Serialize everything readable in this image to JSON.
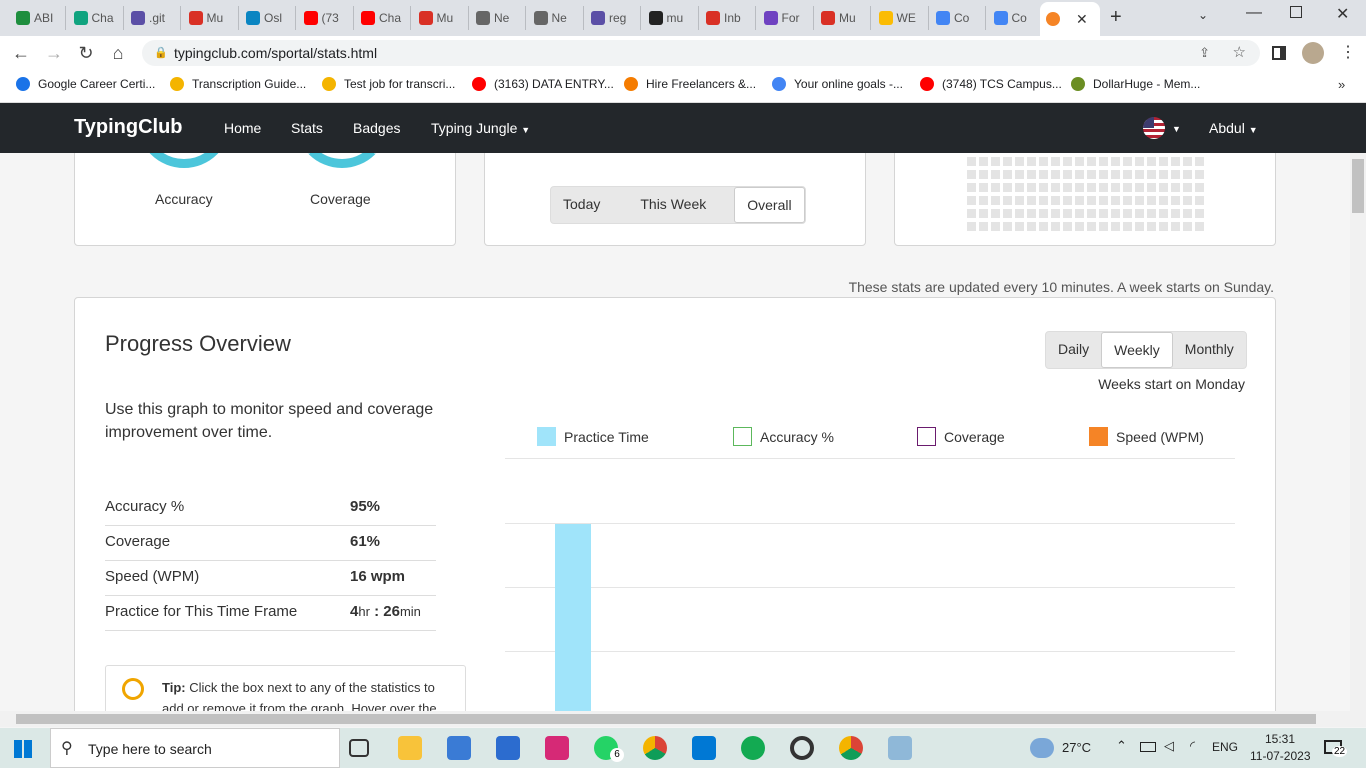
{
  "tabs": [
    {
      "label": "ABI",
      "color": "#1e8e3e",
      "icon": "sheets-icon"
    },
    {
      "label": "Cha",
      "color": "#10a37f",
      "icon": "chatgpt-icon"
    },
    {
      "label": ".git",
      "color": "#5b4fa6",
      "icon": "github-icon"
    },
    {
      "label": "Mu",
      "color": "#d93025",
      "icon": "gmail-icon"
    },
    {
      "label": "Osl",
      "color": "#0a85c2",
      "icon": "app-icon"
    },
    {
      "label": "(73",
      "color": "#ff0000",
      "icon": "youtube-icon"
    },
    {
      "label": "Cha",
      "color": "#ff0000",
      "icon": "youtube-icon"
    },
    {
      "label": "Mu",
      "color": "#d93025",
      "icon": "gmail-icon"
    },
    {
      "label": "Ne",
      "color": "#666",
      "icon": "globe-icon"
    },
    {
      "label": "Ne",
      "color": "#666",
      "icon": "globe-icon"
    },
    {
      "label": "reg",
      "color": "#5b4fa6",
      "icon": "github-icon"
    },
    {
      "label": "mu",
      "color": "#222",
      "icon": "github-icon"
    },
    {
      "label": "Inb",
      "color": "#d93025",
      "icon": "gmail-icon"
    },
    {
      "label": "For",
      "color": "#6f42c1",
      "icon": "bootstrap-icon"
    },
    {
      "label": "Mu",
      "color": "#d93025",
      "icon": "gmail-icon"
    },
    {
      "label": "WE",
      "color": "#fbbc04",
      "icon": "drive-icon"
    },
    {
      "label": "Co",
      "color": "#4285f4",
      "icon": "docs-icon"
    },
    {
      "label": "Co",
      "color": "#4285f4",
      "icon": "docs-icon"
    }
  ],
  "url": "typingclub.com/sportal/stats.html",
  "bookmarks": [
    {
      "label": "Google Career Certi...",
      "color": "#1a73e8"
    },
    {
      "label": "Transcription Guide...",
      "color": "#f4b400"
    },
    {
      "label": "Test job for transcri...",
      "color": "#f4b400"
    },
    {
      "label": "(3163) DATA ENTRY...",
      "color": "#ff0000"
    },
    {
      "label": "Hire Freelancers &...",
      "color": "#f57c00"
    },
    {
      "label": "Your online goals -...",
      "color": "#4285f4"
    },
    {
      "label": "(3748) TCS Campus...",
      "color": "#ff0000"
    },
    {
      "label": "DollarHuge - Mem...",
      "color": "#6b8e23"
    }
  ],
  "site": {
    "brand": "TypingClub",
    "nav": [
      "Home",
      "Stats",
      "Badges",
      "Typing Jungle"
    ],
    "user": "Abdul"
  },
  "top": {
    "accuracy_label": "Accuracy",
    "coverage_label": "Coverage",
    "periods": [
      "Today",
      "This Week",
      "Overall"
    ],
    "selected": "Overall"
  },
  "update_note": "These stats are updated every 10 minutes. A week starts on Sunday.",
  "progress": {
    "title": "Progress Overview",
    "intervals": [
      "Daily",
      "Weekly",
      "Monthly"
    ],
    "selected": "Weekly",
    "week_note": "Weeks start on Monday",
    "description": "Use this graph to monitor speed and coverage improvement over time.",
    "stats": [
      {
        "label": "Accuracy %",
        "value": "95%"
      },
      {
        "label": "Coverage",
        "value": "61%"
      },
      {
        "label": "Speed (WPM)",
        "value": "16 wpm"
      }
    ],
    "practice": {
      "label": "Practice for This Time Frame",
      "hr": "4",
      "hr_unit": "hr",
      "sep": ":",
      "min": "26",
      "min_unit": "min"
    },
    "tip_label": "Tip:",
    "tip_text": "Click the box next to any of the statistics to add or remove it from the graph. Hover over the"
  },
  "chart_data": {
    "type": "bar",
    "series": [
      {
        "name": "Practice Time",
        "color": "#a0e4fa"
      },
      {
        "name": "Accuracy %",
        "color": "#5cb85c"
      },
      {
        "name": "Coverage",
        "color": "#6a1b6e"
      },
      {
        "name": "Speed (WPM)",
        "color": "#f58426"
      }
    ],
    "legend_position": "top"
  },
  "taskbar": {
    "search": "Type here to search",
    "temp": "27°C",
    "lang": "ENG",
    "time": "15:31",
    "date": "11-07-2023",
    "notif": "22",
    "whatsapp_badge": "6"
  }
}
